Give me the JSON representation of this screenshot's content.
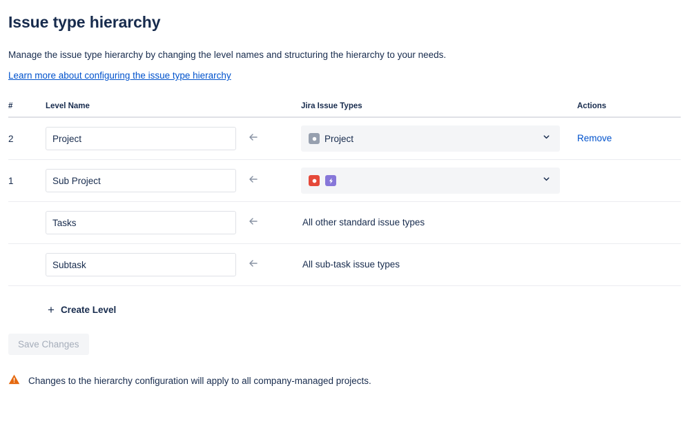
{
  "header": {
    "title": "Issue type hierarchy",
    "description": "Manage the issue type hierarchy by changing the level names and structuring the hierarchy to your needs.",
    "learn_more_link": "Learn more about configuring the issue type hierarchy"
  },
  "table": {
    "columns": {
      "number": "#",
      "level_name": "Level Name",
      "jira_issue_types": "Jira Issue Types",
      "actions": "Actions"
    },
    "rows": [
      {
        "number": "2",
        "level_name_value": "Project",
        "arrow_icon": "arrow-left-icon",
        "types_kind": "select",
        "types_label": "Project",
        "types_icons": [
          "project-icon"
        ],
        "chevron_icon": "chevron-down-icon",
        "action_label": "Remove"
      },
      {
        "number": "1",
        "level_name_value": "Sub Project",
        "arrow_icon": "arrow-left-icon",
        "types_kind": "select",
        "types_label": "",
        "types_icons": [
          "story-icon",
          "epic-icon"
        ],
        "chevron_icon": "chevron-down-icon",
        "action_label": ""
      },
      {
        "number": "",
        "level_name_value": "Tasks",
        "arrow_icon": "arrow-left-icon",
        "types_kind": "text",
        "types_label": "All other standard issue types",
        "types_icons": [],
        "chevron_icon": "",
        "action_label": ""
      },
      {
        "number": "",
        "level_name_value": "Subtask",
        "arrow_icon": "arrow-left-icon",
        "types_kind": "text",
        "types_label": "All sub-task issue types",
        "types_icons": [],
        "chevron_icon": "",
        "action_label": ""
      }
    ]
  },
  "actions": {
    "create_level_label": "Create Level",
    "create_level_icon": "plus-icon",
    "save_changes_label": "Save Changes"
  },
  "warning": {
    "icon": "warning-triangle-icon",
    "message": "Changes to the hierarchy configuration will apply to all company-managed projects."
  },
  "colors": {
    "link": "#0052cc",
    "text": "#172b4d",
    "select_bg": "#f4f5f7",
    "project_icon": "#97a0af",
    "story_icon": "#e5493a",
    "epic_icon": "#8777d9",
    "warning": "#e56910",
    "divider": "#ebecf0",
    "header_divider": "#dfe1e6"
  }
}
